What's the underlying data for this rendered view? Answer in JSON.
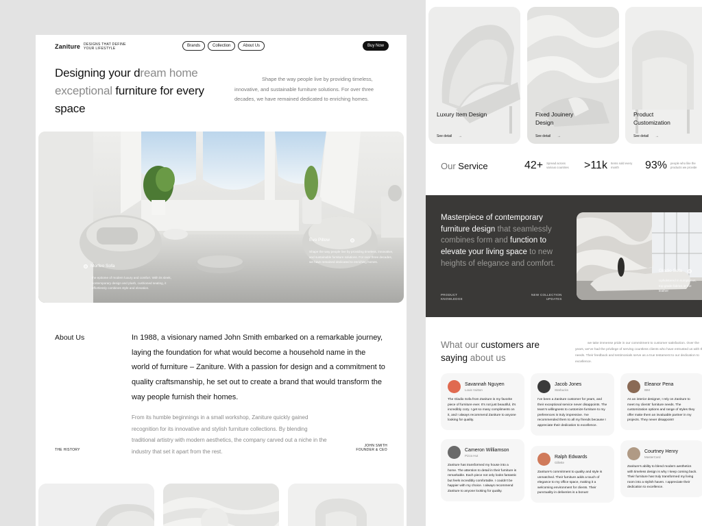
{
  "left": {
    "logo": "Zaniture",
    "tagline": "DESIGNS THAT DEFINE YOUR LIFESTYLE",
    "nav": [
      "Brands",
      "Collection",
      "About Us"
    ],
    "buy_label": "Buy Now",
    "hero": {
      "title_part1": "Designing your d",
      "title_part2": "ream home exceptional ",
      "title_part3": "furniture for every space",
      "description": "Shape the way people live by providing timeless, innovative, and sustainable furniture solutions. For over three decades, we have remained dedicated to enriching homes."
    },
    "products": [
      {
        "name": "Morfeo Sofa",
        "desc": "the epitome of modern luxury and comfort. With its sleek, contemporary design and plush, cushioned seating, it effortlessly combines style and elevation."
      },
      {
        "name": "Evo Pillow",
        "desc": "Shape the way people live by providing timeless, innovative, and sustainable furniture solutions. For over three decades, we have remained dedicated to enriching homes."
      }
    ],
    "about": {
      "heading": "About Us",
      "main": "In 1988, a visionary named John Smith embarked on a remarkable journey, laying the foundation for what would become a household name in the world of furniture – Zaniture. With a passion for design and a commitment to quality craftsmanship, he set out to create a brand that would transform the way people furnish their homes.",
      "sub": "From its humble beginnings in a small workshop, Zaniture quickly gained recognition for its innovative and stylish furniture collections. By blending traditional artistry with modern aesthetics, the company carved out a niche in the industry that set it apart from the rest.",
      "history_label": "THE HISTORY",
      "founder_name": "JOHN SMITH",
      "founder_role": "FOUNDER & CEO"
    }
  },
  "right": {
    "cards": [
      {
        "title": "Luxury Item Design",
        "link": "See detail"
      },
      {
        "title": "Fixed Jouinery Design",
        "link": "See detail"
      },
      {
        "title": "Product Customization",
        "link": "See detail"
      }
    ],
    "service": {
      "title_part1": "Our ",
      "title_part2": "Service",
      "stats": [
        {
          "value": "42+",
          "label": "Spread across various countries"
        },
        {
          "value": ">11k",
          "label": "Items sold every month"
        },
        {
          "value": "93%",
          "label": "people who like the products we provide"
        }
      ]
    },
    "feature": {
      "t1": "Masterpiece of contemporary furniture design",
      "t2": " that seamlessly combines form and ",
      "t3": "function to elevate your living space",
      "t4": " to new heights of elegance and comfort.",
      "label1_line1": "PRODUCT",
      "label1_line2": "KNOWLEDGE",
      "label2_line1": "NEW COLLECTION",
      "label2_line2": "UPDATES",
      "product_name": "Gladio Sofa",
      "product_desc": "Upholstered in sumptuous, top-grade fabrics or the leather"
    },
    "customers": {
      "title_part1": "What our ",
      "title_part2": "customers are saying",
      "title_part3": " about us",
      "description": "we take immense pride in our commitment to customer satisfaction. Over the years, we've had the privilege of serving countless clients who have entrusted us with their needs. Their feedback and testimonials serve as a true testament to our dedication to excellence."
    },
    "reviews": [
      {
        "name": "Savannah Nguyen",
        "company": "Louis Vuitton",
        "text": "The Gladio Sofa from Zaniture is my favorite piece of furniture ever. It's not just beautiful, it's incredibly cozy. I get so many compliments on it, and I always recommend Zaniture to anyone looking for quality.",
        "avatar_color": "#e06a50"
      },
      {
        "name": "Jacob Jones",
        "company": "Starbucks",
        "text": "I've been a Zaniture customer for years, and their exceptional service never disappoints. The team's willingness to customize furniture to my preferences is truly impressive. I've recommended them to all my friends because I appreciate their dedication to excellence.",
        "avatar_color": "#3a3a3a"
      },
      {
        "name": "Eleanor Pena",
        "company": "IBM",
        "text": "As an interior designer, I rely on Zaniture to meet my clients' furniture needs. The customization options and range of styles they offer make them an invaluable partner in my projects. They never disappoint!",
        "avatar_color": "#8a6a55"
      },
      {
        "name": "Cameron Williamson",
        "company": "Pizza Hut",
        "text": "Zaniture has transformed my house into a home. The attention to detail in their furniture is remarkable. Each piece not only looks fantastic but feels incredibly comfortable. I couldn't be happier with my choice. I always recommend Zaniture to anyone looking for quality.",
        "avatar_color": "#6a6a6a"
      },
      {
        "name": "Ralph Edwards",
        "company": "Gillette",
        "text": "Zaniture's commitment to quality and style is unmatched. Their furniture adds a touch of elegance to my office space, making it a welcoming environment for clients. Their punctuality in deliveries is a bonus!",
        "avatar_color": "#d07a5a"
      },
      {
        "name": "Courtney Henry",
        "company": "MasterCard",
        "text": "Zaniture's ability to blend modern aesthetics with timeless design is why I keep coming back. Their furniture has truly transformed my living room into a stylish haven. I appreciate their dedication to excellence.",
        "avatar_color": "#b09a85"
      }
    ]
  }
}
